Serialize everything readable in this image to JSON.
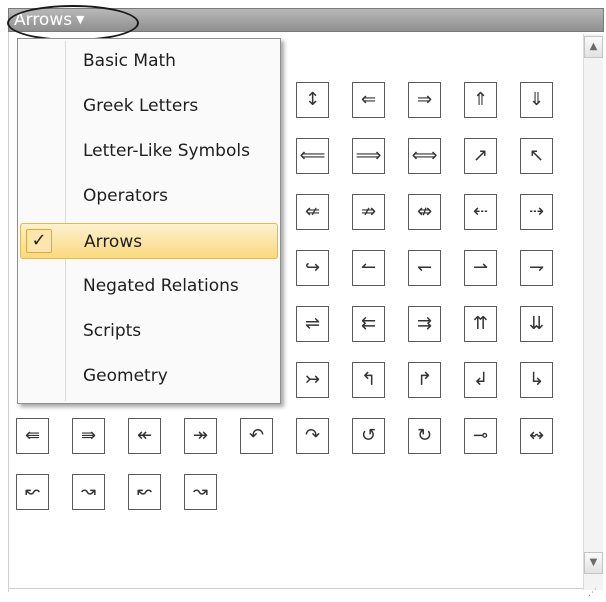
{
  "header": {
    "title": "Arrows",
    "dropdown_icon": "caret-down-icon"
  },
  "menu": {
    "items": [
      {
        "label": "Basic Math",
        "selected": false
      },
      {
        "label": "Greek Letters",
        "selected": false
      },
      {
        "label": "Letter-Like Symbols",
        "selected": false
      },
      {
        "label": "Operators",
        "selected": false
      },
      {
        "label": "Arrows",
        "selected": true
      },
      {
        "label": "Negated Relations",
        "selected": false
      },
      {
        "label": "Scripts",
        "selected": false
      },
      {
        "label": "Geometry",
        "selected": false
      }
    ],
    "check_glyph": "✓"
  },
  "symbols": {
    "rows": [
      [
        "",
        "",
        "",
        "",
        "",
        "↕",
        "⇐",
        "⇒",
        "⇑",
        "⇓"
      ],
      [
        "",
        "",
        "",
        "",
        "",
        "⟸",
        "⟹",
        "⟺",
        "↗",
        "↖"
      ],
      [
        "",
        "",
        "",
        "",
        "",
        "⇍",
        "⇏",
        "⇎",
        "⇠",
        "⇢"
      ],
      [
        "",
        "",
        "",
        "",
        "",
        "↪",
        "↼",
        "↽",
        "⇀",
        "⇁"
      ],
      [
        "",
        "",
        "",
        "",
        "",
        "⇌",
        "⇇",
        "⇉",
        "⇈",
        "⇊"
      ],
      [
        "",
        "",
        "",
        "",
        "",
        "↣",
        "↰",
        "↱",
        "↲",
        "↳"
      ],
      [
        "⇚",
        "⇛",
        "↞",
        "↠",
        "↶",
        "↷",
        "↺",
        "↻",
        "⊸",
        "↭"
      ],
      [
        "↜",
        "↝",
        "↜",
        "↝"
      ]
    ]
  },
  "scrollbar": {
    "up_icon": "▲",
    "down_icon": "▼",
    "grip": "⋰"
  }
}
